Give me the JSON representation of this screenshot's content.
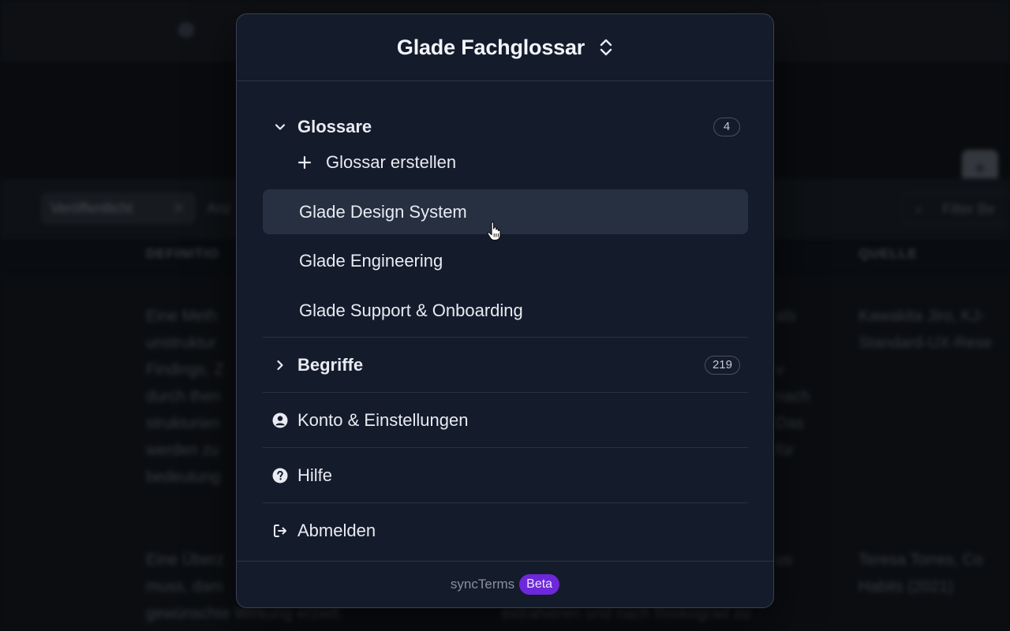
{
  "background": {
    "chip_label": "Veröffentlicht",
    "tab_label": "Anz",
    "search_placeholder": "Filter Be",
    "columns": {
      "definition": "DEFINITIO",
      "source": "QUELLE"
    },
    "row1": {
      "definition": [
        "Eine Meth",
        "unstruktur",
        "Findings, Z",
        "durch then",
        "strukturien",
        "werden zu",
        "bedeutung"
      ],
      "middle": [
        "als",
        "",
        "v",
        "nach",
        "Das",
        "für"
      ],
      "source": [
        "Kawakita Jiro, KJ-",
        "Standard-UX-Rese"
      ]
    },
    "row2": {
      "definition": [
        "Eine Überz",
        "muss, dam",
        "gewünschte Wirkung erzielt."
      ],
      "middle": [
        "us",
        "",
        "extrahieren und nach Risikograd zu"
      ],
      "source": [
        "Teresa Torres, Co",
        "Habits (2021)"
      ]
    }
  },
  "panel": {
    "title": "Glade Fachglossar",
    "sections": {
      "glossare": {
        "label": "Glossare",
        "count": "4",
        "create_label": "Glossar erstellen"
      },
      "begriffe": {
        "label": "Begriffe",
        "count": "219"
      }
    },
    "glossaries": [
      {
        "label": "Glade Design System"
      },
      {
        "label": "Glade Engineering"
      },
      {
        "label": "Glade Support & Onboarding"
      }
    ],
    "account_label": "Konto & Einstellungen",
    "help_label": "Hilfe",
    "logout_label": "Abmelden",
    "footer": {
      "app_name": "syncTerms",
      "badge": "Beta"
    }
  },
  "colors": {
    "panel_bg": "#141b2b",
    "hover_bg": "#263041",
    "beta": "#6d28d9"
  },
  "icons": {
    "header": "chevron-up-down-icon",
    "glossare": "chevron-down-icon",
    "create": "plus-icon",
    "begriffe": "chevron-right-icon",
    "account": "user-circle-icon",
    "help": "question-circle-icon",
    "logout": "logout-icon",
    "cursor": "hand-pointer-icon"
  }
}
